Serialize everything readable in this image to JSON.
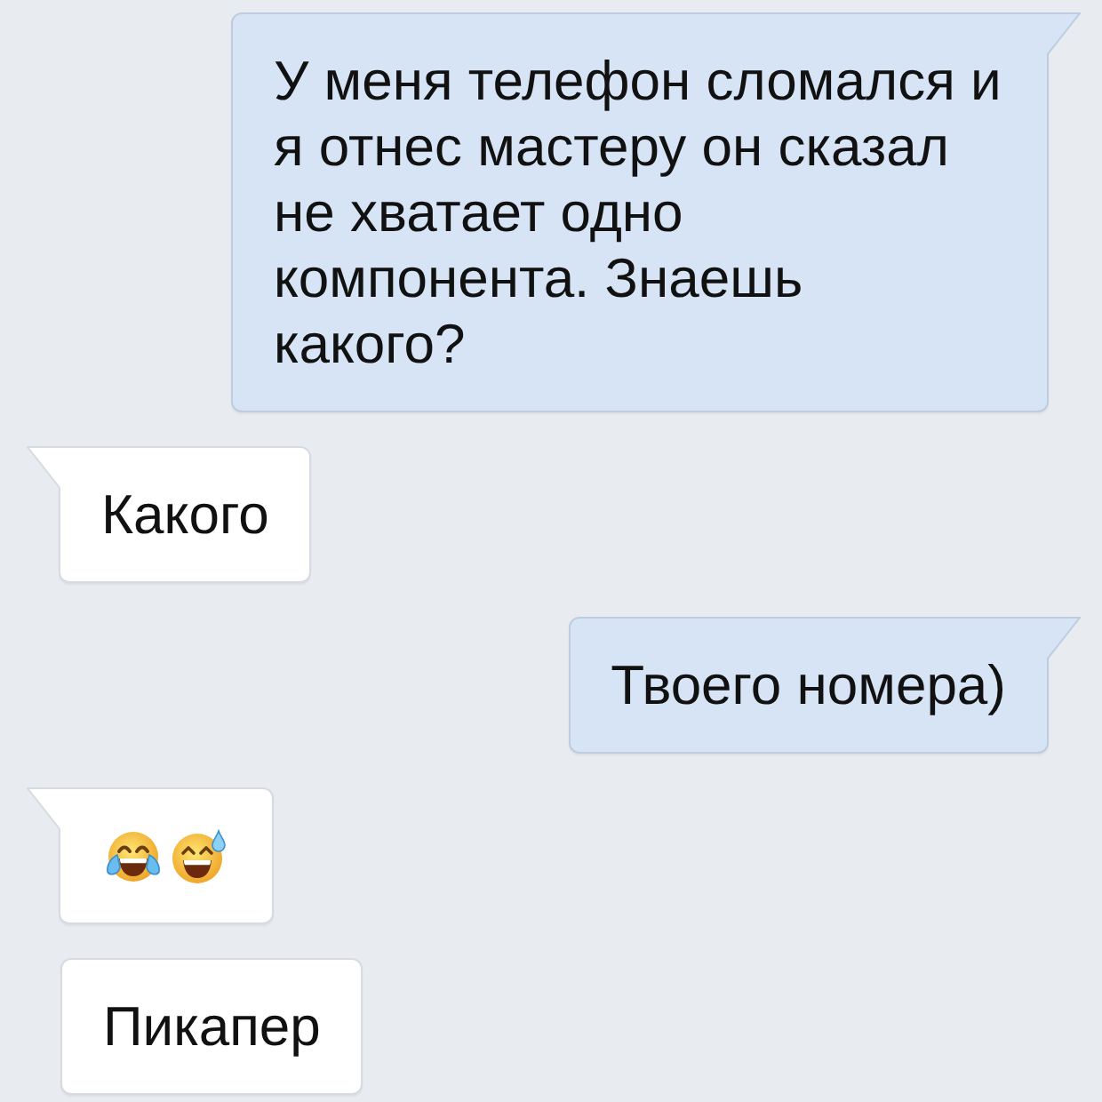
{
  "messages": [
    {
      "outgoing": true,
      "tail": true,
      "kind": "text",
      "text": "У меня телефон сломался и я отнес мастеру он сказал не хватает одно компонента. Знаешь какого?"
    },
    {
      "outgoing": false,
      "tail": true,
      "kind": "text",
      "text": "Какого"
    },
    {
      "outgoing": true,
      "tail": true,
      "kind": "text",
      "text": "Твоего номера)"
    },
    {
      "outgoing": false,
      "tail": true,
      "kind": "emoji"
    },
    {
      "outgoing": false,
      "tail": false,
      "kind": "text",
      "text": "Пикапер"
    }
  ]
}
